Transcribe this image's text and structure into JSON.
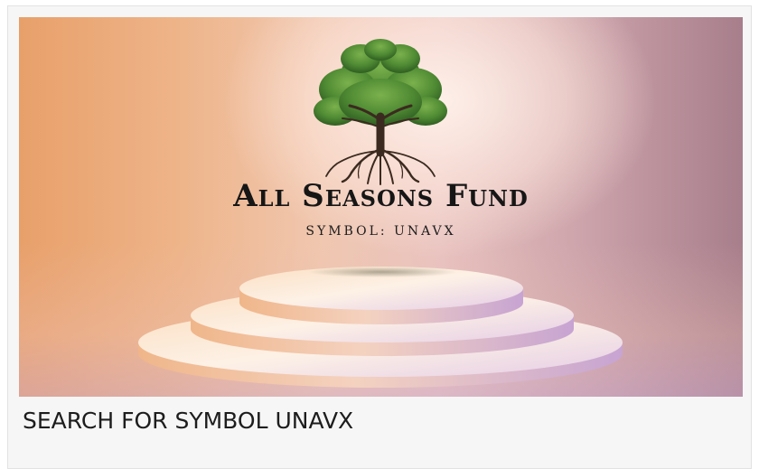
{
  "banner": {
    "brand_name": "All Seasons Fund",
    "symbol_line": "SYMBOL: UNAVX",
    "logo_icon": "oak-tree-icon",
    "colors": {
      "foliage": "#4f8a33",
      "trunk": "#3b2a1f",
      "text": "#161616",
      "background_left": "#e8a06a",
      "background_right": "#a77e8b"
    }
  },
  "caption": {
    "text": "SEARCH FOR SYMBOL UNAVX"
  }
}
